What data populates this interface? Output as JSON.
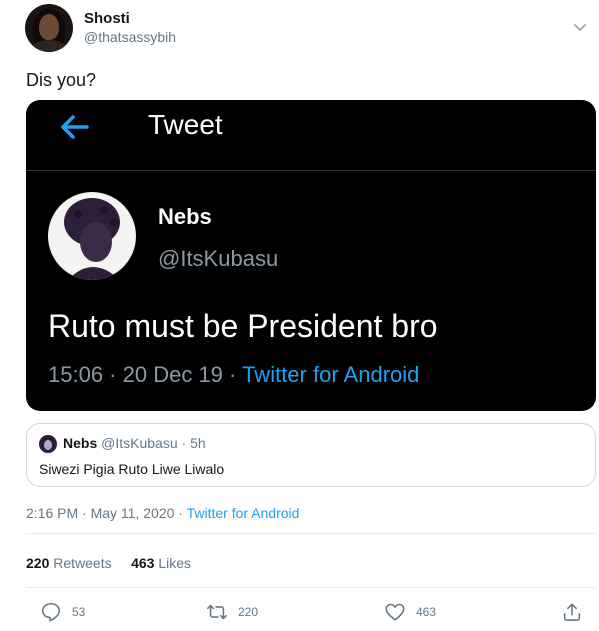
{
  "author": {
    "display_name": "Shosti",
    "handle": "@thatsassybih"
  },
  "tweet": {
    "text": "Dis you?"
  },
  "screenshot": {
    "title": "Tweet",
    "name": "Nebs",
    "handle": "@ItsKubasu",
    "text": "Ruto must be President bro",
    "time": "15:06",
    "date": "20 Dec 19",
    "source": "Twitter for Android"
  },
  "quote": {
    "name": "Nebs",
    "handle": "@ItsKubasu",
    "age": "5h",
    "text": "Siwezi Pigia Ruto Liwe Liwalo"
  },
  "meta": {
    "time": "2:16 PM",
    "date": "May 11, 2020",
    "source": "Twitter for Android"
  },
  "stats": {
    "retweets_count": "220",
    "retweets_label": "Retweets",
    "likes_count": "463",
    "likes_label": "Likes"
  },
  "actions": {
    "reply_count": "53",
    "retweet_count": "220",
    "like_count": "463"
  },
  "colors": {
    "accent": "#1da1f2",
    "muted": "#657786"
  }
}
